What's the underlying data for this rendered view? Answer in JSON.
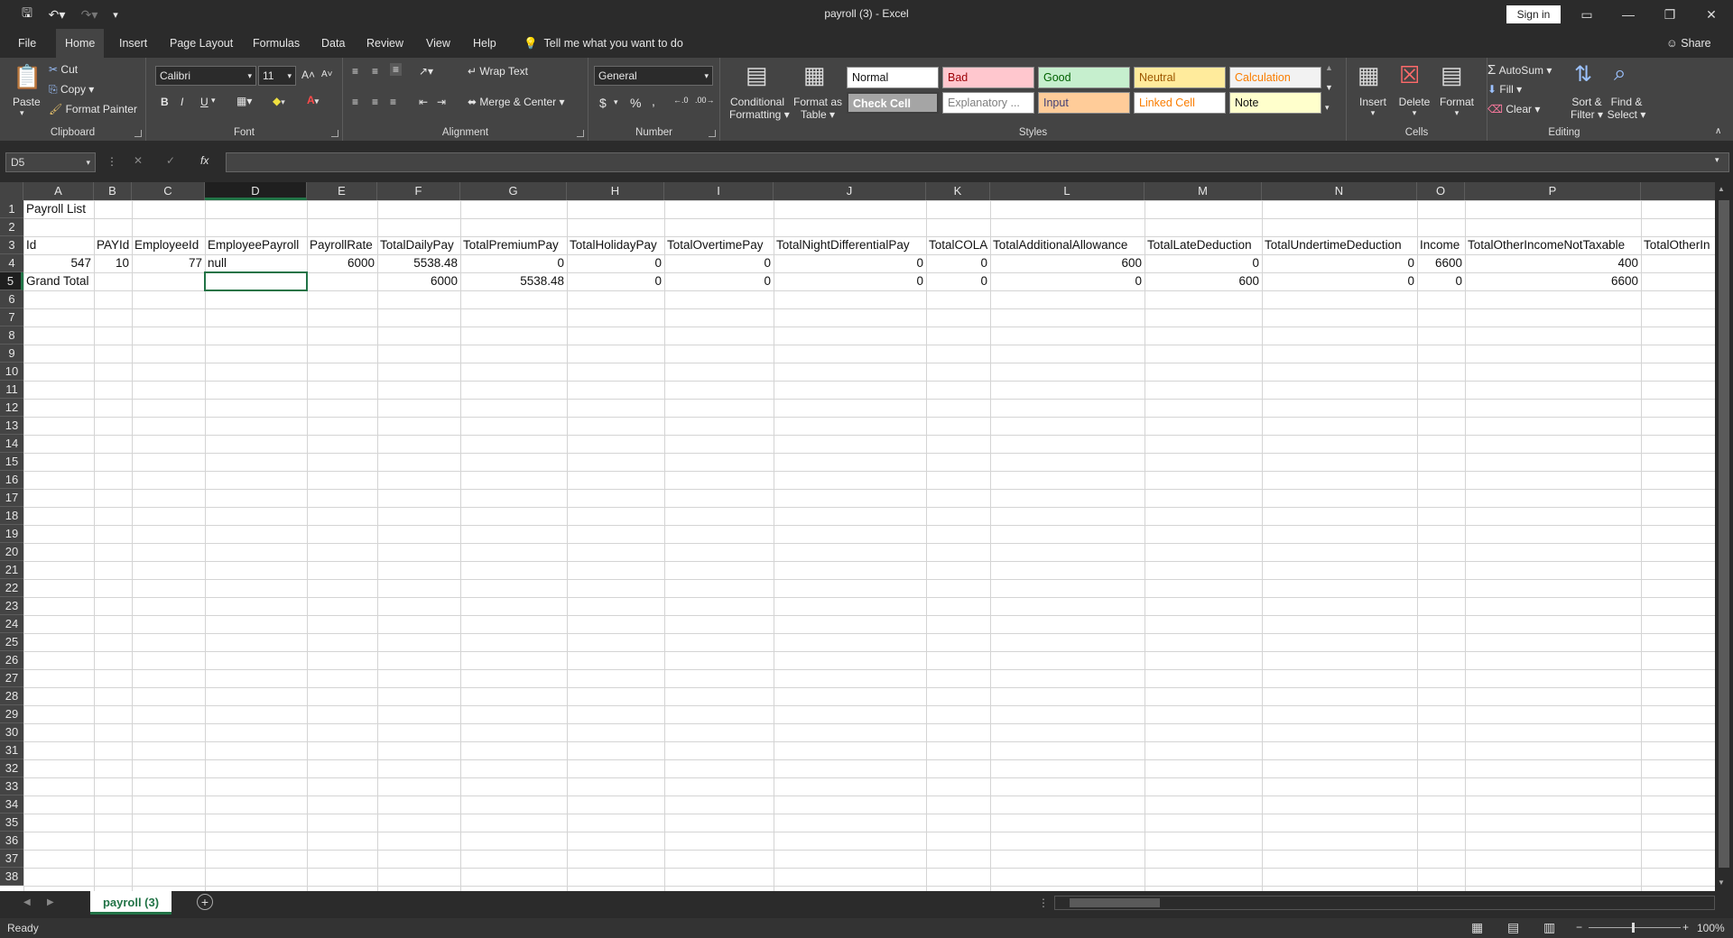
{
  "window": {
    "title": "payroll (3)  -  Excel",
    "sign_in": "Sign in"
  },
  "tabs": [
    "File",
    "Home",
    "Insert",
    "Page Layout",
    "Formulas",
    "Data",
    "Review",
    "View",
    "Help"
  ],
  "tell_me": "Tell me what you want to do",
  "share": "Share",
  "ribbon": {
    "clipboard": {
      "label": "Clipboard",
      "paste": "Paste",
      "cut": "Cut",
      "copy": "Copy",
      "format_painter": "Format Painter"
    },
    "font": {
      "label": "Font",
      "name": "Calibri",
      "size": "11",
      "bold": "B",
      "italic": "I",
      "underline": "U"
    },
    "alignment": {
      "label": "Alignment",
      "wrap_text": "Wrap Text",
      "merge_center": "Merge & Center"
    },
    "number": {
      "label": "Number",
      "format": "General",
      "currency": "$",
      "percent": "%",
      "comma": ","
    },
    "styles": {
      "label": "Styles",
      "conditional": "Conditional",
      "formatting": "Formatting",
      "format_as": "Format as",
      "table": "Table",
      "gallery": [
        {
          "name": "Normal",
          "bg": "#ffffff",
          "fg": "#111111"
        },
        {
          "name": "Bad",
          "bg": "#ffc7ce",
          "fg": "#9c0006"
        },
        {
          "name": "Good",
          "bg": "#c6efce",
          "fg": "#006100"
        },
        {
          "name": "Neutral",
          "bg": "#ffeb9c",
          "fg": "#9c5700"
        },
        {
          "name": "Calculation",
          "bg": "#f2f2f2",
          "fg": "#fa7d00"
        },
        {
          "name": "Check Cell",
          "bg": "#a5a5a5",
          "fg": "#ffffff"
        },
        {
          "name": "Explanatory ...",
          "bg": "#ffffff",
          "fg": "#7f7f7f"
        },
        {
          "name": "Input",
          "bg": "#ffcc99",
          "fg": "#3f3f76"
        },
        {
          "name": "Linked Cell",
          "bg": "#ffffff",
          "fg": "#fa7d00"
        },
        {
          "name": "Note",
          "bg": "#ffffcc",
          "fg": "#111111"
        }
      ]
    },
    "cells": {
      "label": "Cells",
      "insert": "Insert",
      "delete": "Delete",
      "format": "Format"
    },
    "editing": {
      "label": "Editing",
      "autosum": "AutoSum",
      "fill": "Fill",
      "clear": "Clear",
      "sort": "Sort &",
      "filter": "Filter",
      "find": "Find &",
      "select": "Select"
    }
  },
  "formula_bar": {
    "name_box": "D5",
    "fx": "fx",
    "value": ""
  },
  "columns": [
    "A",
    "B",
    "C",
    "D",
    "E",
    "F",
    "G",
    "H",
    "I",
    "J",
    "K",
    "L",
    "M",
    "N",
    "O",
    "P"
  ],
  "rows": [
    "1",
    "2",
    "3",
    "4",
    "5",
    "6",
    "7",
    "8",
    "9",
    "10",
    "11",
    "12",
    "13",
    "14",
    "15",
    "16",
    "17",
    "18",
    "19",
    "20",
    "21",
    "22",
    "23",
    "24",
    "25",
    "26",
    "27",
    "28",
    "29",
    "30",
    "31",
    "32",
    "33",
    "34",
    "35",
    "36",
    "37",
    "38"
  ],
  "cells": {
    "r1": {
      "A": "Payroll List"
    },
    "r3": {
      "A": "Id",
      "B": "PAYId",
      "C": "EmployeeId",
      "D": "EmployeePayroll",
      "E": "PayrollRate",
      "F": "TotalDailyPay",
      "G": "TotalPremiumPay",
      "H": "TotalHolidayPay",
      "I": "TotalOvertimePay",
      "J": "TotalNightDifferentialPay",
      "K": "TotalCOLA",
      "L": "TotalAdditionalAllowance",
      "M": "TotalLateDeduction",
      "N": "TotalUndertimeDeduction",
      "O": "Income",
      "P": "TotalOtherIncomeNotTaxable",
      "Q": "TotalOtherIn"
    },
    "r4": {
      "A": "547",
      "B": "10",
      "C": "77",
      "D": "null",
      "E": "6000",
      "F": "5538.48",
      "G": "0",
      "H": "0",
      "I": "0",
      "J": "0",
      "K": "0",
      "L": "600",
      "M": "0",
      "N": "0",
      "O": "6600",
      "P": "400"
    },
    "r5": {
      "A": "Grand Total",
      "F": "6000",
      "G": "5538.48",
      "H": "0",
      "I": "0",
      "J": "0",
      "K": "0",
      "L": "0",
      "M": "600",
      "N": "0",
      "O": "0",
      "P": "6600"
    }
  },
  "sheet_tab": "payroll (3)",
  "status": {
    "ready": "Ready",
    "zoom": "100%"
  }
}
